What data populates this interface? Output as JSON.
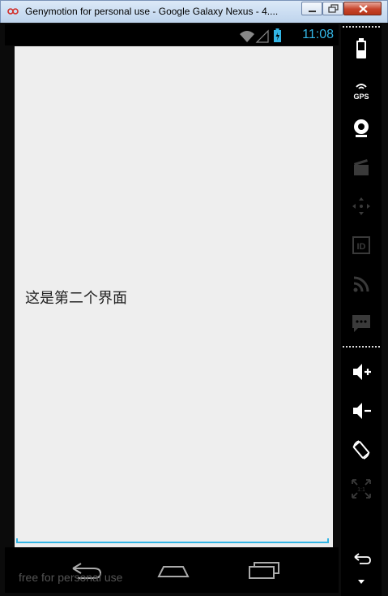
{
  "window": {
    "title": "Genymotion for personal use - Google Galaxy Nexus - 4...."
  },
  "status_bar": {
    "time": "11:08"
  },
  "screen": {
    "text": "这是第二个界面"
  },
  "watermark": "free for personal use",
  "toolbar": {
    "gps_label": "GPS",
    "id_label": "ID",
    "pixel_perfect_label": "1:1"
  },
  "colors": {
    "accent": "#33b5e5",
    "screen_bg": "#eeeeee",
    "toolbar_icon_active": "#ffffff",
    "toolbar_icon_disabled": "#3a3a3a"
  }
}
